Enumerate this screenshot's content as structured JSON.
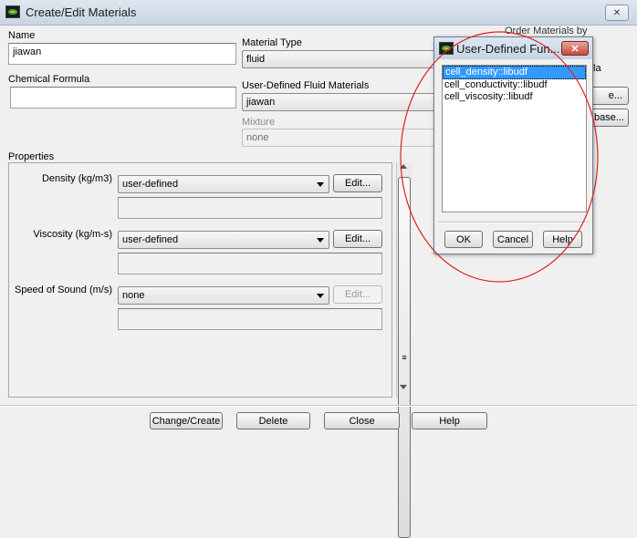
{
  "window": {
    "title": "Create/Edit Materials",
    "close_label": "✕"
  },
  "form": {
    "name_label": "Name",
    "name_value": "jiawan",
    "formula_label": "Chemical Formula",
    "formula_value": "",
    "material_type_label": "Material Type",
    "material_type_value": "fluid",
    "udf_materials_label": "User-Defined Fluid Materials",
    "udf_materials_value": "jiawan",
    "mixture_label": "Mixture",
    "mixture_value": "none",
    "order_label": "Order Materials by",
    "order_option_partial": "la",
    "right_btn1_partial": "e...",
    "right_btn2_partial": "base..."
  },
  "properties": {
    "label": "Properties",
    "rows": [
      {
        "label": "Density (kg/m3)",
        "method": "user-defined",
        "edit": "Edit..."
      },
      {
        "label": "Viscosity (kg/m-s)",
        "method": "user-defined",
        "edit": "Edit..."
      },
      {
        "label": "Speed of Sound (m/s)",
        "method": "none",
        "edit": "Edit..."
      }
    ],
    "scroll_thumb_glyph": "≡"
  },
  "bottom_buttons": {
    "change_create": "Change/Create",
    "delete": "Delete",
    "close": "Close",
    "help": "Help"
  },
  "udf_dialog": {
    "title": "User-Defined Fun...",
    "close_label": "✕",
    "items": [
      "cell_density::libudf",
      "cell_conductivity::libudf",
      "cell_viscosity::libudf"
    ],
    "selected_index": 0,
    "ok": "OK",
    "cancel": "Cancel",
    "help": "Help"
  },
  "colors": {
    "selection": "#3399ff",
    "annotation_circle": "#e02020",
    "dialog_close": "#c8473a"
  }
}
